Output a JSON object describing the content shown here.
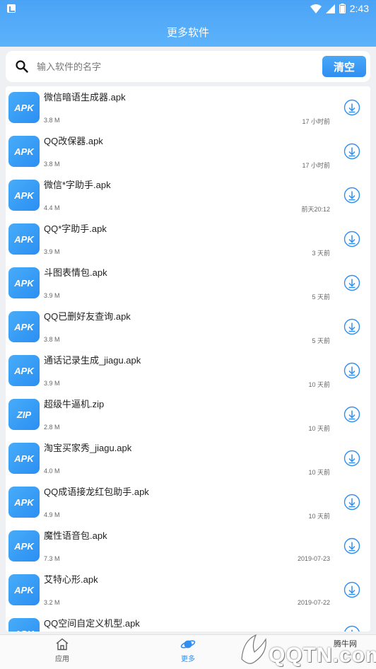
{
  "status_bar": {
    "time": "2:43"
  },
  "header": {
    "title": "更多软件"
  },
  "search": {
    "placeholder": "输入软件的名字",
    "value": "",
    "clear_label": "清空"
  },
  "files": [
    {
      "type": "APK",
      "name": "微信暗语生成器.apk",
      "size": "3.8 M",
      "time": "17 小时前"
    },
    {
      "type": "APK",
      "name": "QQ改保器.apk",
      "size": "3.8 M",
      "time": "17 小时前"
    },
    {
      "type": "APK",
      "name": "微信*字助手.apk",
      "size": "4.4 M",
      "time": "前天20:12"
    },
    {
      "type": "APK",
      "name": "QQ*字助手.apk",
      "size": "3.9 M",
      "time": "3 天前"
    },
    {
      "type": "APK",
      "name": "斗图表情包.apk",
      "size": "3.9 M",
      "time": "5 天前"
    },
    {
      "type": "APK",
      "name": "QQ已删好友查询.apk",
      "size": "3.8 M",
      "time": "5 天前"
    },
    {
      "type": "APK",
      "name": "通话记录生成_jiagu.apk",
      "size": "3.9 M",
      "time": "10 天前"
    },
    {
      "type": "ZIP",
      "name": "超级牛逼机.zip",
      "size": "2.8 M",
      "time": "10 天前"
    },
    {
      "type": "APK",
      "name": "淘宝买家秀_jiagu.apk",
      "size": "4.0 M",
      "time": "10 天前"
    },
    {
      "type": "APK",
      "name": "QQ成语接龙红包助手.apk",
      "size": "4.9 M",
      "time": "10 天前"
    },
    {
      "type": "APK",
      "name": "魔性语音包.apk",
      "size": "7.3 M",
      "time": "2019-07-23"
    },
    {
      "type": "APK",
      "name": "艾特心形.apk",
      "size": "3.2 M",
      "time": "2019-07-22"
    },
    {
      "type": "APK",
      "name": "QQ空间自定义机型.apk",
      "size": "",
      "time": ""
    }
  ],
  "bottom_nav": {
    "apps_label": "应用",
    "more_label": "更多"
  },
  "watermark": {
    "site": "腾牛网",
    "text": "QQTN.com"
  },
  "colors": {
    "accent": "#2f8ef0",
    "header": "#4ba3f6"
  }
}
